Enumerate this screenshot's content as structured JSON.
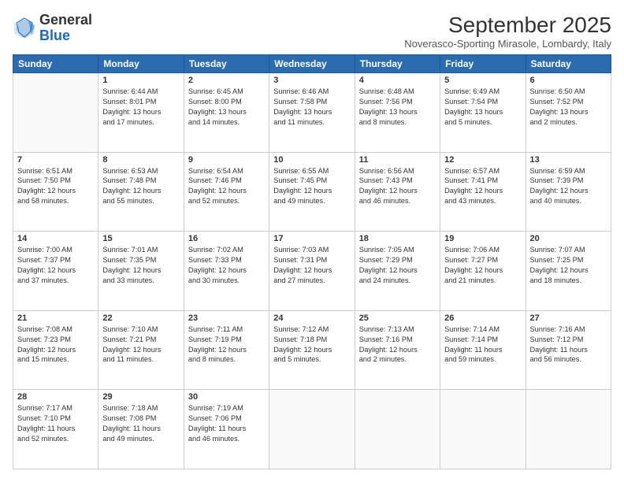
{
  "header": {
    "logo_general": "General",
    "logo_blue": "Blue",
    "month_title": "September 2025",
    "location": "Noverasco-Sporting Mirasole, Lombardy, Italy"
  },
  "weekdays": [
    "Sunday",
    "Monday",
    "Tuesday",
    "Wednesday",
    "Thursday",
    "Friday",
    "Saturday"
  ],
  "weeks": [
    [
      {
        "day": "",
        "info": ""
      },
      {
        "day": "1",
        "info": "Sunrise: 6:44 AM\nSunset: 8:01 PM\nDaylight: 13 hours\nand 17 minutes."
      },
      {
        "day": "2",
        "info": "Sunrise: 6:45 AM\nSunset: 8:00 PM\nDaylight: 13 hours\nand 14 minutes."
      },
      {
        "day": "3",
        "info": "Sunrise: 6:46 AM\nSunset: 7:58 PM\nDaylight: 13 hours\nand 11 minutes."
      },
      {
        "day": "4",
        "info": "Sunrise: 6:48 AM\nSunset: 7:56 PM\nDaylight: 13 hours\nand 8 minutes."
      },
      {
        "day": "5",
        "info": "Sunrise: 6:49 AM\nSunset: 7:54 PM\nDaylight: 13 hours\nand 5 minutes."
      },
      {
        "day": "6",
        "info": "Sunrise: 6:50 AM\nSunset: 7:52 PM\nDaylight: 13 hours\nand 2 minutes."
      }
    ],
    [
      {
        "day": "7",
        "info": "Sunrise: 6:51 AM\nSunset: 7:50 PM\nDaylight: 12 hours\nand 58 minutes."
      },
      {
        "day": "8",
        "info": "Sunrise: 6:53 AM\nSunset: 7:48 PM\nDaylight: 12 hours\nand 55 minutes."
      },
      {
        "day": "9",
        "info": "Sunrise: 6:54 AM\nSunset: 7:46 PM\nDaylight: 12 hours\nand 52 minutes."
      },
      {
        "day": "10",
        "info": "Sunrise: 6:55 AM\nSunset: 7:45 PM\nDaylight: 12 hours\nand 49 minutes."
      },
      {
        "day": "11",
        "info": "Sunrise: 6:56 AM\nSunset: 7:43 PM\nDaylight: 12 hours\nand 46 minutes."
      },
      {
        "day": "12",
        "info": "Sunrise: 6:57 AM\nSunset: 7:41 PM\nDaylight: 12 hours\nand 43 minutes."
      },
      {
        "day": "13",
        "info": "Sunrise: 6:59 AM\nSunset: 7:39 PM\nDaylight: 12 hours\nand 40 minutes."
      }
    ],
    [
      {
        "day": "14",
        "info": "Sunrise: 7:00 AM\nSunset: 7:37 PM\nDaylight: 12 hours\nand 37 minutes."
      },
      {
        "day": "15",
        "info": "Sunrise: 7:01 AM\nSunset: 7:35 PM\nDaylight: 12 hours\nand 33 minutes."
      },
      {
        "day": "16",
        "info": "Sunrise: 7:02 AM\nSunset: 7:33 PM\nDaylight: 12 hours\nand 30 minutes."
      },
      {
        "day": "17",
        "info": "Sunrise: 7:03 AM\nSunset: 7:31 PM\nDaylight: 12 hours\nand 27 minutes."
      },
      {
        "day": "18",
        "info": "Sunrise: 7:05 AM\nSunset: 7:29 PM\nDaylight: 12 hours\nand 24 minutes."
      },
      {
        "day": "19",
        "info": "Sunrise: 7:06 AM\nSunset: 7:27 PM\nDaylight: 12 hours\nand 21 minutes."
      },
      {
        "day": "20",
        "info": "Sunrise: 7:07 AM\nSunset: 7:25 PM\nDaylight: 12 hours\nand 18 minutes."
      }
    ],
    [
      {
        "day": "21",
        "info": "Sunrise: 7:08 AM\nSunset: 7:23 PM\nDaylight: 12 hours\nand 15 minutes."
      },
      {
        "day": "22",
        "info": "Sunrise: 7:10 AM\nSunset: 7:21 PM\nDaylight: 12 hours\nand 11 minutes."
      },
      {
        "day": "23",
        "info": "Sunrise: 7:11 AM\nSunset: 7:19 PM\nDaylight: 12 hours\nand 8 minutes."
      },
      {
        "day": "24",
        "info": "Sunrise: 7:12 AM\nSunset: 7:18 PM\nDaylight: 12 hours\nand 5 minutes."
      },
      {
        "day": "25",
        "info": "Sunrise: 7:13 AM\nSunset: 7:16 PM\nDaylight: 12 hours\nand 2 minutes."
      },
      {
        "day": "26",
        "info": "Sunrise: 7:14 AM\nSunset: 7:14 PM\nDaylight: 11 hours\nand 59 minutes."
      },
      {
        "day": "27",
        "info": "Sunrise: 7:16 AM\nSunset: 7:12 PM\nDaylight: 11 hours\nand 56 minutes."
      }
    ],
    [
      {
        "day": "28",
        "info": "Sunrise: 7:17 AM\nSunset: 7:10 PM\nDaylight: 11 hours\nand 52 minutes."
      },
      {
        "day": "29",
        "info": "Sunrise: 7:18 AM\nSunset: 7:08 PM\nDaylight: 11 hours\nand 49 minutes."
      },
      {
        "day": "30",
        "info": "Sunrise: 7:19 AM\nSunset: 7:06 PM\nDaylight: 11 hours\nand 46 minutes."
      },
      {
        "day": "",
        "info": ""
      },
      {
        "day": "",
        "info": ""
      },
      {
        "day": "",
        "info": ""
      },
      {
        "day": "",
        "info": ""
      }
    ]
  ]
}
